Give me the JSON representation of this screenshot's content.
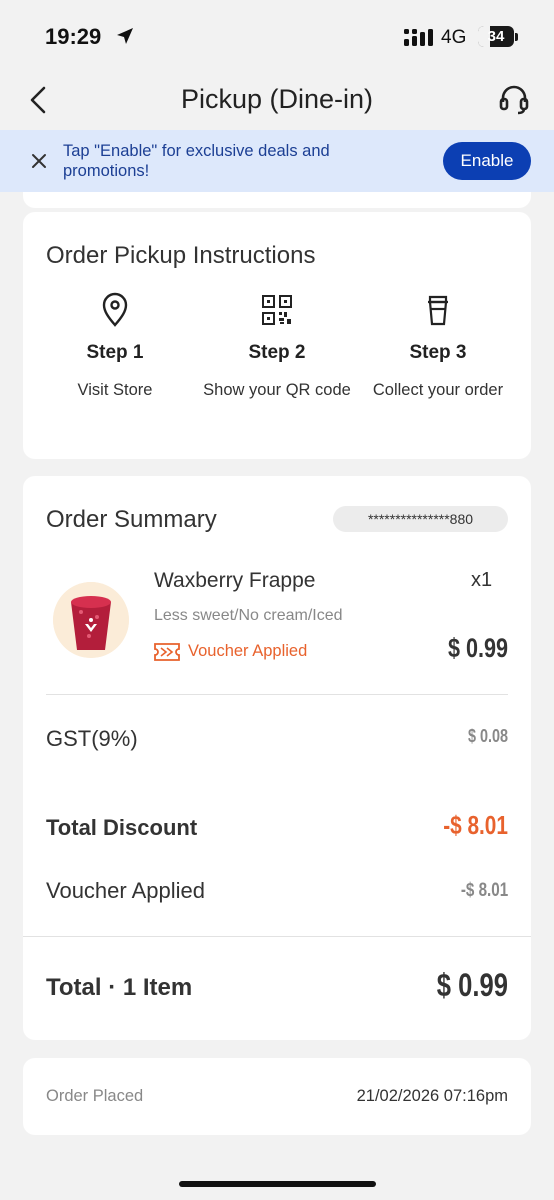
{
  "status": {
    "time": "19:29",
    "network": "4G",
    "battery": "34",
    "battery_level": 0.34
  },
  "nav": {
    "title": "Pickup (Dine-in)"
  },
  "banner": {
    "text": "Tap \"Enable\" for exclusive deals and promotions!",
    "button": "Enable"
  },
  "instructions": {
    "heading": "Order Pickup Instructions",
    "steps": [
      {
        "icon": "location-pin-icon",
        "title": "Step 1",
        "desc": "Visit Store"
      },
      {
        "icon": "qr-code-icon",
        "title": "Step 2",
        "desc": "Show your QR code"
      },
      {
        "icon": "coffee-cup-icon",
        "title": "Step 3",
        "desc": "Collect your order"
      }
    ]
  },
  "summary": {
    "heading": "Order Summary",
    "phone": "***************880",
    "item": {
      "name": "Waxberry Frappe",
      "qty": "x1",
      "options": "Less sweet/No cream/Iced",
      "voucher": "Voucher Applied",
      "price": "$ 0.99"
    },
    "gst": {
      "label": "GST(9%)",
      "value": "$ 0.08"
    },
    "discount": {
      "label": "Total Discount",
      "value": "-$ 8.01"
    },
    "voucher_applied": {
      "label": "Voucher Applied",
      "value": "-$ 8.01"
    },
    "total": {
      "label": "Total · 1 Item",
      "value": "$ 0.99"
    }
  },
  "placed": {
    "label": "Order Placed",
    "value": "21/02/2026 07:16pm"
  },
  "colors": {
    "accent_blue": "#0c3fb3",
    "banner_bg": "#dde8fb",
    "discount_orange": "#e8622d"
  }
}
